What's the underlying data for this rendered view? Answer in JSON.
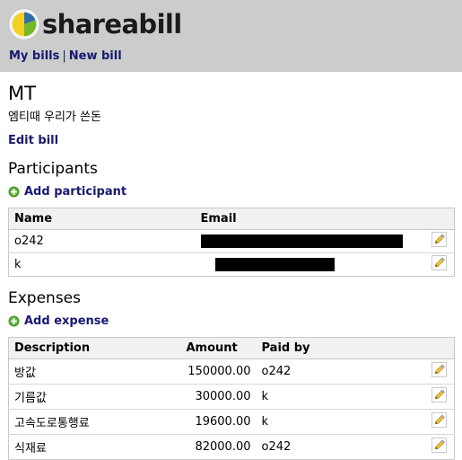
{
  "app": {
    "brand_name": "shareabill",
    "logo_icon": "pie-chart-logo-icon",
    "logo_colors": {
      "yellow": "#f2d024",
      "blue": "#2f6fa8",
      "green": "#76b82a"
    },
    "link_color": "#191970",
    "header_bg": "#cccccc"
  },
  "nav": {
    "my_bills": "My bills",
    "separator": "|",
    "new_bill": "New bill"
  },
  "bill": {
    "title": "MT",
    "description": "엠티때 우리가 쓴돈",
    "edit_link": "Edit bill"
  },
  "participants": {
    "heading": "Participants",
    "add_label": "Add participant",
    "add_icon": "plus-circle-icon",
    "columns": [
      "Name",
      "Email"
    ],
    "rows": [
      {
        "name": "o242",
        "email_redacted": true,
        "email_bar_width": 225,
        "edit_icon": "pencil-icon"
      },
      {
        "name": "k",
        "email_redacted": true,
        "email_bar_width": 133,
        "edit_icon": "pencil-icon"
      }
    ]
  },
  "expenses": {
    "heading": "Expenses",
    "add_label": "Add expense",
    "add_icon": "plus-circle-icon",
    "columns": [
      "Description",
      "Amount",
      "Paid by"
    ],
    "rows": [
      {
        "description": "방값",
        "amount": "150000.00",
        "paid_by": "o242",
        "edit_icon": "pencil-icon"
      },
      {
        "description": "기름값",
        "amount": "30000.00",
        "paid_by": "k",
        "edit_icon": "pencil-icon"
      },
      {
        "description": "고속도로통행료",
        "amount": "19600.00",
        "paid_by": "k",
        "edit_icon": "pencil-icon"
      },
      {
        "description": "식재료",
        "amount": "82000.00",
        "paid_by": "o242",
        "edit_icon": "pencil-icon"
      }
    ]
  }
}
